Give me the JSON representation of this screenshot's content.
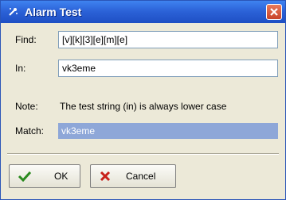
{
  "window": {
    "title": "Alarm Test",
    "title_icon": "wand-icon",
    "close_icon": "close-icon",
    "titlebar_color": "#2c63d8",
    "close_color": "#d9573a"
  },
  "form": {
    "find_label": "Find:",
    "find_value": "[v][k][3][e][m][e]",
    "in_label": "In:",
    "in_value": "vk3eme",
    "note_label": "Note:",
    "note_text": "The test string (in) is always lower case",
    "match_label": "Match:",
    "match_value": "vk3eme",
    "match_highlight_color": "#8ea7d8"
  },
  "buttons": {
    "ok_label": "OK",
    "ok_icon": "checkmark-icon",
    "cancel_label": "Cancel",
    "cancel_icon": "cross-icon"
  }
}
